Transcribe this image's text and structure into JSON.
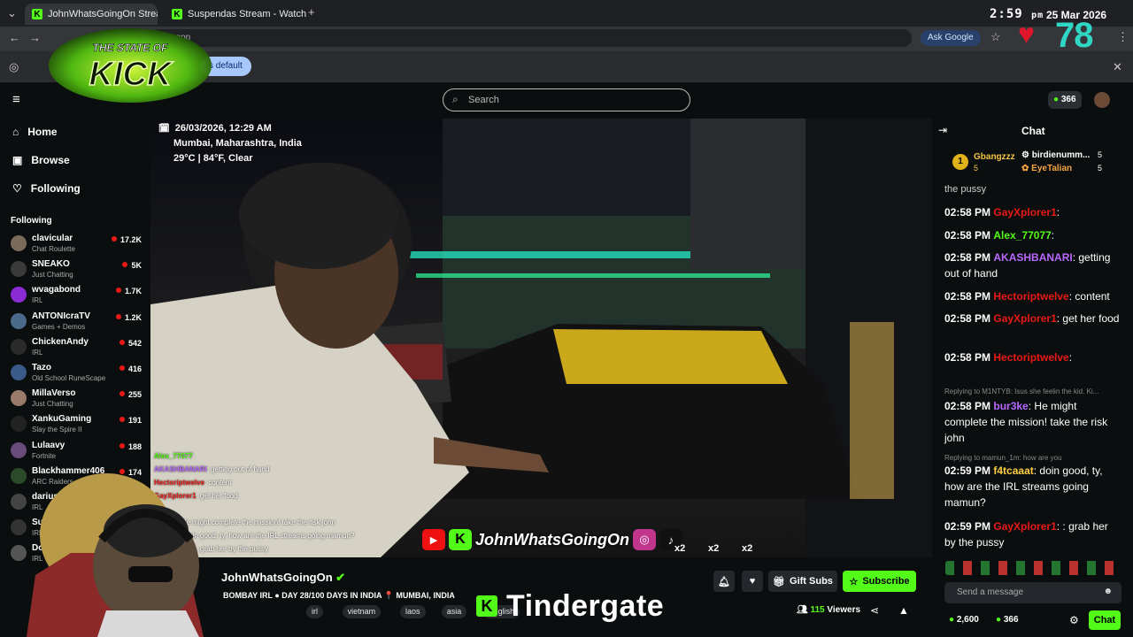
{
  "browser": {
    "tabs": [
      {
        "label": "JohnWhatsGoingOn Stream"
      },
      {
        "label": "Suspendas Stream - Watch Live"
      }
    ],
    "url_fragment": "tingon",
    "infobar_button": "s default",
    "ask_google": "Ask Google"
  },
  "overlay": {
    "time": "2:59",
    "ampm": "pm",
    "date": "25 Mar 2026",
    "counter": "78",
    "logo_line1": "THE STATE OF",
    "logo_line2": "KICK"
  },
  "kick_header": {
    "search_placeholder": "Search",
    "points": "366"
  },
  "sidebar": {
    "nav": [
      {
        "label": "Home"
      },
      {
        "label": "Browse"
      },
      {
        "label": "Following"
      }
    ],
    "following_heading": "Following",
    "channels": [
      {
        "name": "clavicular",
        "category": "Chat Roulette",
        "viewers": "17.2K"
      },
      {
        "name": "SNEAKO",
        "category": "Just Chatting",
        "viewers": "5K"
      },
      {
        "name": "wvagabond",
        "category": "IRL",
        "viewers": "1.7K"
      },
      {
        "name": "ANTONIcraTV",
        "category": "Games + Demos",
        "viewers": "1.2K"
      },
      {
        "name": "ChickenAndy",
        "category": "IRL",
        "viewers": "542"
      },
      {
        "name": "Tazo",
        "category": "Old School RuneScape",
        "viewers": "416"
      },
      {
        "name": "MillaVerso",
        "category": "Just Chatting",
        "viewers": "255"
      },
      {
        "name": "XankuGaming",
        "category": "Slay the Spire II",
        "viewers": "191"
      },
      {
        "name": "Lulaavy",
        "category": "Fortnite",
        "viewers": "188"
      },
      {
        "name": "Blackhammer406",
        "category": "ARC Raiders",
        "viewers": "174"
      },
      {
        "name": "dariusirl",
        "category": "IRL",
        "viewers": ""
      },
      {
        "name": "Suspen",
        "category": "IRL",
        "viewers": ""
      },
      {
        "name": "Dohm",
        "category": "IRL",
        "viewers": ""
      }
    ]
  },
  "video": {
    "datetime": "26/03/2026, 12:29 AM",
    "location": "Mumbai, Maharashtra, India",
    "weather": "29°C | 84°F, Clear",
    "brand_name": "JohnWhatsGoingOn",
    "x2a": "x2",
    "x2b": "x2",
    "x2c": "x2",
    "embedded_chat": [
      {
        "user": "Alex_77077",
        "text": ":"
      },
      {
        "user": "AKASHBANARI",
        "text": ": getting out of hand"
      },
      {
        "user": "Hectoriptwelve",
        "text": ": content"
      },
      {
        "user": "GayXplorer1",
        "text": ": get her food"
      },
      {
        "user": "",
        "text": ""
      },
      {
        "user": "bur3ke",
        "text": ": He might complete the mission! take the risk john"
      },
      {
        "user": "f4tcaaat",
        "text": ": doin good, ty, how are the IRL streams going mamun?"
      },
      {
        "user": "GayXplorer1",
        "text": ": grab her by the pussy"
      }
    ]
  },
  "stream_info": {
    "channel": "JohnWhatsGoingOn",
    "title": "BOMBAY IRL ● DAY 28/100 DAYS IN INDIA 📍 MUMBAI, INDIA",
    "tags": [
      "irl",
      "vietnam",
      "laos",
      "asia",
      "English"
    ],
    "overlay_label": "Tindergate",
    "gift_subs": "Gift Subs",
    "subscribe": "Subscribe",
    "viewers_count": "115",
    "viewers_label": "Viewers"
  },
  "chat": {
    "title": "Chat",
    "leaderboard": [
      {
        "rank": "1",
        "name": "Gbangzzz",
        "count": "5"
      },
      {
        "name": "birdienumm...",
        "count": "5"
      },
      {
        "name": "EyeTalian",
        "count": "5"
      }
    ],
    "top_cut": "the pussy",
    "messages": [
      {
        "time": "02:58 PM",
        "user": "GayXplorer1",
        "color": "#e91916",
        "text": ":"
      },
      {
        "time": "02:58 PM",
        "user": "Alex_77077",
        "color": "#53fc18",
        "text": ":"
      },
      {
        "time": "02:58 PM",
        "user": "AKASHBANARI",
        "color": "#b968ff",
        "text": ": getting out of hand"
      },
      {
        "time": "02:58 PM",
        "user": "Hectoriptwelve",
        "color": "#e91916",
        "text": ": content"
      },
      {
        "time": "02:58 PM",
        "user": "GayXplorer1",
        "color": "#e91916",
        "text": ": get her food"
      },
      {
        "time": "02:58 PM",
        "user": "Hectoriptwelve",
        "color": "#e91916",
        "text": ":"
      },
      {
        "time": "02:58 PM",
        "user": "bur3ke",
        "color": "#b968ff",
        "text": ": He might complete the mission! take the risk john"
      },
      {
        "time": "02:59 PM",
        "user": "f4tcaaat",
        "color": "#ffcf3f",
        "text": ": doin good, ty, how are the IRL streams going mamun?"
      },
      {
        "time": "02:59 PM",
        "user": "GayXplorer1",
        "color": "#e91916",
        "text": ": : grab her by the pussy"
      }
    ],
    "reply1": "Replying to M1NTYB: Isus she feelin the kid. Ki...",
    "reply2": "Replying to mamun_1m: how are you",
    "input_placeholder": "Send a message",
    "balance1": "2,600",
    "balance2": "366",
    "send_button": "Chat"
  },
  "colors": {
    "kick_green": "#53fc18",
    "bg": "#0b0e0f"
  }
}
